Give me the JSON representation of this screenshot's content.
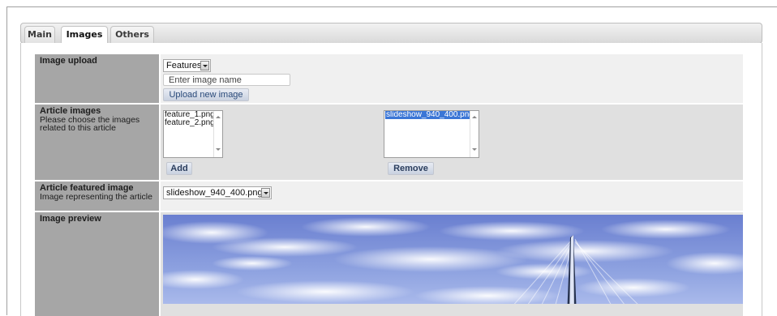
{
  "tabs": [
    {
      "label": "Main",
      "active": false
    },
    {
      "label": "Images",
      "active": true
    },
    {
      "label": "Others",
      "active": false
    }
  ],
  "image_upload": {
    "title": "Image upload",
    "type_select": "Features",
    "name_placeholder": "Enter image name",
    "upload_button": "Upload new image"
  },
  "article_images": {
    "title": "Article images",
    "description": "Please choose the images related to this article",
    "available": [
      "feature_1.png",
      "feature_2.png"
    ],
    "selected": [
      "slideshow_940_400.png"
    ],
    "add_button": "Add",
    "remove_button": "Remove"
  },
  "featured_image": {
    "title": "Article featured image",
    "description": "Image representing the article",
    "value": "slideshow_940_400.png"
  },
  "image_preview": {
    "title": "Image preview"
  },
  "colors": {
    "label_bg": "#a6a6a6",
    "value_bg": "#f0f0f0",
    "value_bg_alt": "#e0e0e0",
    "selection": "#3b76d6",
    "button_text": "#2a4a7a"
  },
  "icons": [
    "dropdown-arrow-icon",
    "scroll-up-icon",
    "scroll-down-icon"
  ]
}
